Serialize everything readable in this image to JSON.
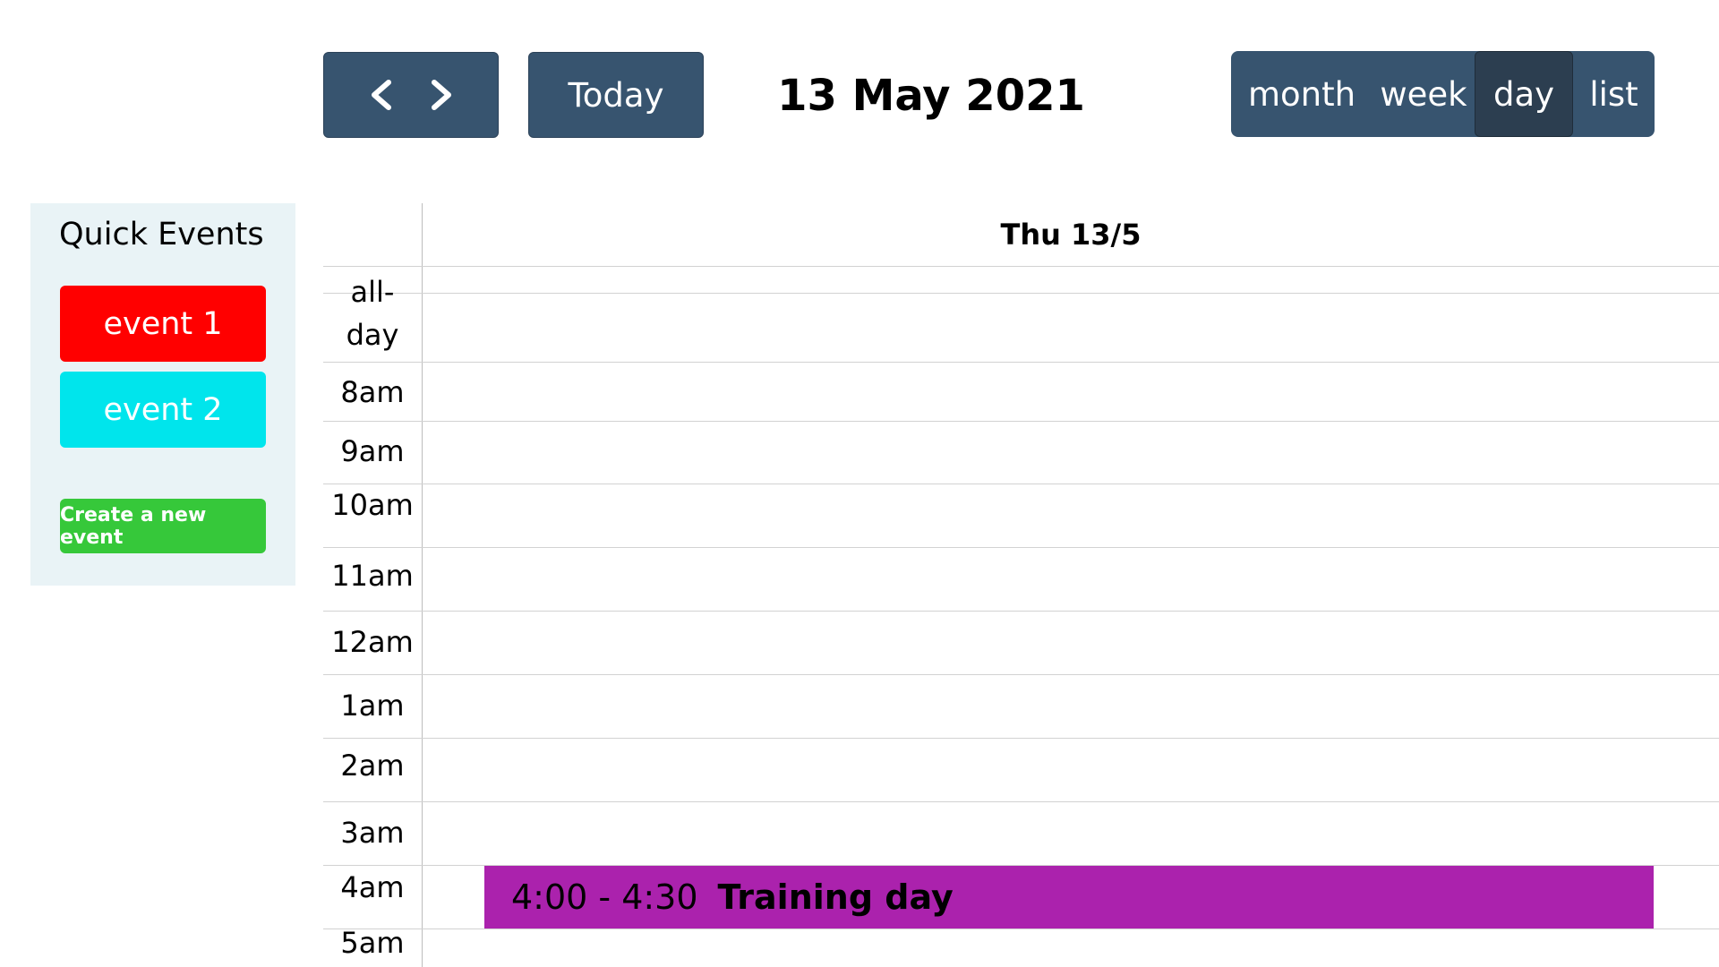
{
  "toolbar": {
    "prev_icon": "chevron-left-icon",
    "next_icon": "chevron-right-icon",
    "today_label": "Today",
    "title": "13 May 2021",
    "views": {
      "month": "month",
      "week": "week",
      "day": "day",
      "list": "list"
    },
    "active_view": "day",
    "colors": {
      "button_bg": "#37546f",
      "button_active_bg": "#2c3e50"
    }
  },
  "sidebar": {
    "title": "Quick Events",
    "events": [
      {
        "label": "event 1",
        "color": "#ff0000"
      },
      {
        "label": "event 2",
        "color": "#00e5ec"
      }
    ],
    "create_label": "Create a new event",
    "create_color": "#36c83a",
    "bg_color": "#e9f3f6"
  },
  "calendar": {
    "day_header": "Thu 13/5",
    "allday_label_1": "all-",
    "allday_label_2": "day",
    "slots": [
      "8am",
      "9am",
      "10am",
      "11am",
      "12am",
      "1am",
      "2am",
      "3am",
      "4am",
      "5am"
    ],
    "event": {
      "time": "4:00 - 4:30",
      "title": "Training day",
      "color": "#ab22ad"
    }
  }
}
